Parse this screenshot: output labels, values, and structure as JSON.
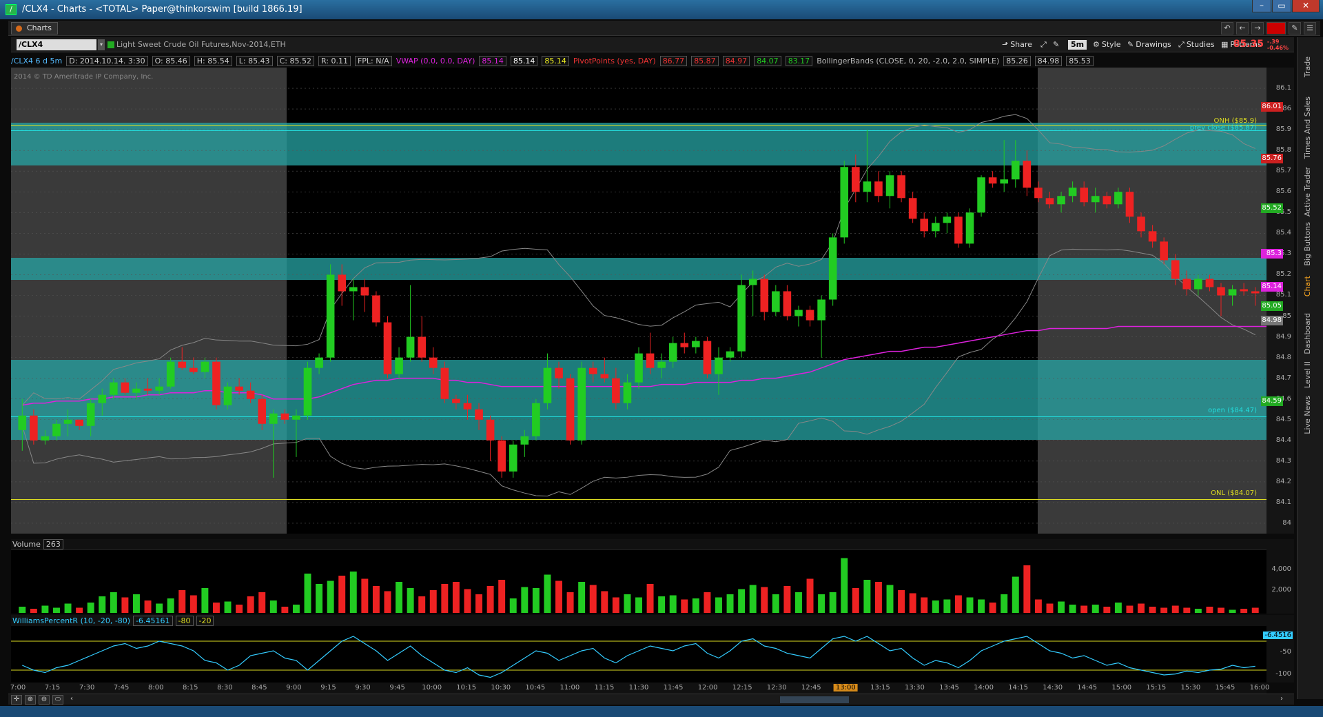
{
  "window": {
    "title": "/CLX4 - Charts - <TOTAL> Paper@thinkorswim [build 1866.19]"
  },
  "tab": {
    "label": "Charts"
  },
  "symbol": {
    "value": "/CLX4",
    "description": "Light Sweet Crude Oil Futures,Nov-2014,ETH"
  },
  "toolbar": {
    "share": "Share",
    "period": "5m",
    "style": "Style",
    "drawings": "Drawings",
    "studies": "Studies",
    "patterns": "Patterns",
    "last_price": "85.35",
    "change_top": "-.39",
    "change_bottom": "-0.46%"
  },
  "studybar": {
    "aggregation": "/CLX4 6 d 5m",
    "date": "D: 2014.10.14. 3:30",
    "open": "O: 85.46",
    "high": "H: 85.54",
    "low": "L: 85.43",
    "close": "C: 85.52",
    "range": "R: 0.11",
    "fpl": "FPL: N/A",
    "vwap_label": "VWAP (0.0, 0.0, DAY)",
    "vwap_v1": "85.14",
    "vwap_v2": "85.14",
    "vwap_v3": "85.14",
    "pivot_label": "PivotPoints (yes, DAY)",
    "pivot_v1": "86.77",
    "pivot_v2": "85.87",
    "pivot_v3": "84.97",
    "pivot_v4": "84.07",
    "pivot_v5": "83.17",
    "bb_label": "BollingerBands (CLOSE, 0, 20, -2.0, 2.0, SIMPLE)",
    "bb_v1": "85.26",
    "bb_v2": "84.98",
    "bb_v3": "85.53"
  },
  "chart": {
    "copyright": "2014 © TD Ameritrade IP Company, Inc.",
    "onh_label": "ONH ($85.9)",
    "prevclose_label": "prev close ($85.87)",
    "open_label": "open ($84.47)",
    "onl_label": "ONL ($84.07)",
    "axis_ticks": [
      "86.1",
      "86",
      "85.9",
      "85.8",
      "85.7",
      "85.6",
      "85.5",
      "85.4",
      "85.3",
      "85.2",
      "85.1",
      "85",
      "84.9",
      "84.8",
      "84.7",
      "84.6",
      "84.5",
      "84.4",
      "84.3",
      "84.2",
      "84.1",
      "84"
    ],
    "tags": [
      {
        "text": "86.01",
        "color": "#cc2020",
        "price": 86.01
      },
      {
        "text": "85.76",
        "color": "#cc2020",
        "price": 85.76
      },
      {
        "text": "85.52",
        "color": "#22aa22",
        "price": 85.52
      },
      {
        "text": "85.3",
        "color": "#dd22dd",
        "price": 85.3
      },
      {
        "text": "85.14",
        "color": "#dd22dd",
        "price": 85.14
      },
      {
        "text": "85.05",
        "color": "#22aa22",
        "price": 85.05
      },
      {
        "text": "84.98",
        "color": "#777777",
        "price": 84.98
      },
      {
        "text": "84.59",
        "color": "#22aa22",
        "price": 84.59
      }
    ]
  },
  "volume": {
    "label": "Volume",
    "value": "263",
    "ticks": [
      "4,000",
      "2,000"
    ]
  },
  "williams": {
    "label": "WilliamsPercentR (10, -20, -80)",
    "value": "-6.45161",
    "p1": "-80",
    "p2": "-20",
    "tag": "-6.4516",
    "ticks": [
      "-50",
      "-100"
    ]
  },
  "timeaxis": {
    "labels": [
      "7:00",
      "7:15",
      "7:30",
      "7:45",
      "8:00",
      "8:15",
      "8:30",
      "8:45",
      "9:00",
      "9:15",
      "9:30",
      "9:45",
      "10:00",
      "10:15",
      "10:30",
      "10:45",
      "11:00",
      "11:15",
      "11:30",
      "11:45",
      "12:00",
      "12:15",
      "12:30",
      "12:45",
      "13:00",
      "13:15",
      "13:30",
      "13:45",
      "14:00",
      "14:15",
      "14:30",
      "14:45",
      "15:00",
      "15:15",
      "15:30",
      "15:45",
      "16:00"
    ],
    "highlight": "13:00"
  },
  "sidetabs": [
    "Trade",
    "Times And Sales",
    "Active Trader",
    "Big Buttons",
    "Chart",
    "Dashboard",
    "Level II",
    "Live News"
  ],
  "colors": {
    "up": "#22cc22",
    "down": "#ee2222",
    "band": "#27a5a5",
    "vwap": "#dd22dd",
    "bollinger": "#888888"
  },
  "chart_data": {
    "type": "candlestick",
    "ylim": [
      83.95,
      86.2
    ],
    "candles": [
      [
        84.45,
        84.6,
        84.35,
        84.52
      ],
      [
        84.52,
        84.55,
        84.38,
        84.4
      ],
      [
        84.4,
        84.45,
        84.38,
        84.42
      ],
      [
        84.42,
        84.5,
        84.4,
        84.48
      ],
      [
        84.48,
        84.55,
        84.42,
        84.5
      ],
      [
        84.5,
        84.5,
        84.45,
        84.47
      ],
      [
        84.47,
        84.6,
        84.42,
        84.58
      ],
      [
        84.58,
        84.65,
        84.52,
        84.62
      ],
      [
        84.62,
        84.7,
        84.6,
        84.68
      ],
      [
        84.68,
        84.7,
        84.62,
        84.63
      ],
      [
        84.63,
        84.68,
        84.6,
        84.65
      ],
      [
        84.65,
        84.7,
        84.62,
        84.64
      ],
      [
        84.64,
        84.7,
        84.62,
        84.66
      ],
      [
        84.66,
        84.8,
        84.65,
        84.78
      ],
      [
        84.78,
        84.85,
        84.74,
        84.75
      ],
      [
        84.75,
        84.8,
        84.72,
        84.73
      ],
      [
        84.73,
        84.8,
        84.7,
        84.78
      ],
      [
        84.78,
        84.8,
        84.55,
        84.57
      ],
      [
        84.57,
        84.68,
        84.55,
        84.66
      ],
      [
        84.66,
        84.7,
        84.62,
        84.64
      ],
      [
        84.64,
        84.68,
        84.58,
        84.6
      ],
      [
        84.6,
        84.62,
        84.45,
        84.48
      ],
      [
        84.48,
        84.55,
        84.22,
        84.53
      ],
      [
        84.53,
        84.55,
        84.48,
        84.5
      ],
      [
        84.5,
        84.55,
        84.32,
        84.52
      ],
      [
        84.52,
        84.78,
        84.5,
        84.75
      ],
      [
        84.75,
        84.82,
        84.72,
        84.8
      ],
      [
        84.8,
        85.25,
        84.78,
        85.2
      ],
      [
        85.2,
        85.25,
        85.05,
        85.12
      ],
      [
        85.12,
        85.18,
        84.98,
        85.14
      ],
      [
        85.14,
        85.18,
        85.02,
        85.1
      ],
      [
        85.1,
        85.12,
        84.95,
        84.97
      ],
      [
        84.97,
        85.0,
        84.7,
        84.72
      ],
      [
        84.72,
        84.85,
        84.7,
        84.8
      ],
      [
        84.8,
        85.15,
        84.78,
        84.9
      ],
      [
        84.9,
        85.0,
        84.78,
        84.8
      ],
      [
        84.8,
        84.85,
        84.72,
        84.75
      ],
      [
        84.75,
        84.78,
        84.58,
        84.6
      ],
      [
        84.6,
        84.62,
        84.55,
        84.58
      ],
      [
        84.58,
        84.62,
        84.5,
        84.55
      ],
      [
        84.55,
        84.58,
        84.45,
        84.5
      ],
      [
        84.5,
        84.52,
        84.3,
        84.4
      ],
      [
        84.4,
        84.42,
        84.22,
        84.25
      ],
      [
        84.25,
        84.4,
        84.22,
        84.38
      ],
      [
        84.38,
        84.45,
        84.32,
        84.42
      ],
      [
        84.42,
        84.6,
        84.4,
        84.58
      ],
      [
        84.58,
        84.82,
        84.55,
        84.75
      ],
      [
        84.75,
        84.78,
        84.65,
        84.7
      ],
      [
        84.7,
        84.72,
        84.38,
        84.4
      ],
      [
        84.4,
        84.78,
        84.38,
        84.75
      ],
      [
        84.75,
        84.78,
        84.68,
        84.72
      ],
      [
        84.72,
        84.8,
        84.68,
        84.7
      ],
      [
        84.7,
        84.75,
        84.55,
        84.58
      ],
      [
        84.58,
        84.72,
        84.55,
        84.68
      ],
      [
        84.68,
        84.85,
        84.65,
        84.82
      ],
      [
        84.82,
        84.92,
        84.72,
        84.75
      ],
      [
        84.75,
        84.82,
        84.7,
        84.78
      ],
      [
        84.78,
        84.9,
        84.75,
        84.87
      ],
      [
        84.87,
        84.92,
        84.82,
        84.85
      ],
      [
        84.85,
        84.9,
        84.82,
        84.88
      ],
      [
        84.88,
        84.9,
        84.7,
        84.72
      ],
      [
        84.72,
        84.85,
        84.62,
        84.8
      ],
      [
        84.8,
        84.85,
        84.78,
        84.83
      ],
      [
        84.83,
        85.2,
        84.8,
        85.15
      ],
      [
        85.15,
        85.22,
        85.0,
        85.18
      ],
      [
        85.18,
        85.2,
        84.98,
        85.02
      ],
      [
        85.02,
        85.15,
        85.0,
        85.12
      ],
      [
        85.12,
        85.15,
        84.98,
        85.0
      ],
      [
        85.0,
        85.05,
        84.95,
        85.03
      ],
      [
        85.03,
        85.05,
        84.95,
        84.98
      ],
      [
        84.98,
        85.1,
        84.8,
        85.08
      ],
      [
        85.08,
        85.4,
        85.05,
        85.38
      ],
      [
        85.38,
        85.75,
        85.35,
        85.72
      ],
      [
        85.72,
        85.78,
        85.55,
        85.6
      ],
      [
        85.6,
        85.9,
        85.55,
        85.65
      ],
      [
        85.65,
        85.7,
        85.55,
        85.58
      ],
      [
        85.58,
        85.7,
        85.52,
        85.68
      ],
      [
        85.68,
        85.7,
        85.55,
        85.57
      ],
      [
        85.57,
        85.6,
        85.45,
        85.47
      ],
      [
        85.47,
        85.5,
        85.38,
        85.41
      ],
      [
        85.41,
        85.48,
        85.38,
        85.45
      ],
      [
        85.45,
        85.5,
        85.4,
        85.48
      ],
      [
        85.48,
        85.5,
        85.33,
        85.35
      ],
      [
        85.35,
        85.52,
        85.33,
        85.5
      ],
      [
        85.5,
        85.68,
        85.48,
        85.67
      ],
      [
        85.67,
        85.7,
        85.62,
        85.64
      ],
      [
        85.64,
        85.85,
        85.6,
        85.66
      ],
      [
        85.66,
        85.85,
        85.62,
        85.75
      ],
      [
        85.75,
        85.8,
        85.58,
        85.62
      ],
      [
        85.62,
        85.65,
        85.55,
        85.57
      ],
      [
        85.57,
        85.6,
        85.52,
        85.54
      ],
      [
        85.54,
        85.6,
        85.5,
        85.58
      ],
      [
        85.58,
        85.65,
        85.55,
        85.62
      ],
      [
        85.62,
        85.65,
        85.53,
        85.55
      ],
      [
        85.55,
        85.62,
        85.5,
        85.58
      ],
      [
        85.58,
        85.6,
        85.52,
        85.54
      ],
      [
        85.54,
        85.62,
        85.52,
        85.6
      ],
      [
        85.6,
        85.62,
        85.45,
        85.48
      ],
      [
        85.48,
        85.5,
        85.38,
        85.41
      ],
      [
        85.41,
        85.44,
        85.33,
        85.36
      ],
      [
        85.36,
        85.38,
        85.25,
        85.27
      ],
      [
        85.27,
        85.3,
        85.15,
        85.18
      ],
      [
        85.18,
        85.22,
        85.1,
        85.13
      ],
      [
        85.13,
        85.2,
        85.1,
        85.18
      ],
      [
        85.18,
        85.2,
        85.12,
        85.14
      ],
      [
        85.14,
        85.16,
        85.0,
        85.1
      ],
      [
        85.1,
        85.15,
        85.05,
        85.13
      ],
      [
        85.13,
        85.16,
        85.1,
        85.12
      ],
      [
        85.12,
        85.14,
        85.05,
        85.11
      ]
    ],
    "volumes": [
      600,
      400,
      700,
      500,
      900,
      500,
      1000,
      1600,
      2000,
      1500,
      1800,
      1200,
      900,
      1400,
      2200,
      1700,
      2400,
      1000,
      1100,
      800,
      1600,
      2000,
      1200,
      600,
      800,
      3800,
      2800,
      3100,
      3600,
      4000,
      3300,
      2600,
      2100,
      3000,
      2400,
      1600,
      2200,
      2800,
      3000,
      2300,
      1800,
      2600,
      3200,
      1400,
      2500,
      2400,
      3700,
      3100,
      2000,
      3000,
      2700,
      2100,
      1500,
      1800,
      1500,
      2800,
      1600,
      1700,
      1300,
      1400,
      2000,
      1500,
      1800,
      2300,
      2700,
      2500,
      1800,
      2600,
      2000,
      3300,
      1800,
      2000,
      5300,
      2400,
      3200,
      3000,
      2700,
      2200,
      1900,
      1500,
      1200,
      1300,
      1700,
      1500,
      1300,
      1000,
      1800,
      3500,
      4600,
      1300,
      900,
      1100,
      800,
      700,
      800,
      600,
      1000,
      700,
      900,
      600,
      500,
      700,
      500,
      400,
      600,
      500,
      300,
      400,
      500,
      300
    ],
    "vwap": [
      84.57,
      84.58,
      84.58,
      84.59,
      84.59,
      84.59,
      84.6,
      84.6,
      84.61,
      84.61,
      84.61,
      84.62,
      84.62,
      84.63,
      84.63,
      84.63,
      84.64,
      84.64,
      84.63,
      84.63,
      84.63,
      84.62,
      84.6,
      84.6,
      84.6,
      84.6,
      84.61,
      84.63,
      84.65,
      84.67,
      84.68,
      84.69,
      84.69,
      84.7,
      84.7,
      84.7,
      84.7,
      84.69,
      84.69,
      84.68,
      84.68,
      84.67,
      84.66,
      84.66,
      84.66,
      84.66,
      84.66,
      84.66,
      84.66,
      84.66,
      84.66,
      84.66,
      84.66,
      84.66,
      84.66,
      84.66,
      84.67,
      84.67,
      84.67,
      84.68,
      84.68,
      84.68,
      84.68,
      84.69,
      84.69,
      84.7,
      84.7,
      84.71,
      84.72,
      84.73,
      84.75,
      84.77,
      84.79,
      84.8,
      84.81,
      84.82,
      84.83,
      84.83,
      84.84,
      84.85,
      84.85,
      84.86,
      84.87,
      84.88,
      84.89,
      84.9,
      84.91,
      84.92,
      84.93,
      84.93,
      84.94,
      84.94,
      84.94,
      84.94,
      84.94,
      84.94,
      84.95,
      84.95,
      84.95,
      84.95,
      84.95,
      84.95,
      84.95,
      84.95,
      84.95,
      84.95,
      84.95,
      84.95,
      84.95,
      84.95
    ],
    "williams": [
      -70,
      -80,
      -85,
      -75,
      -70,
      -60,
      -50,
      -40,
      -30,
      -25,
      -35,
      -30,
      -20,
      -25,
      -30,
      -40,
      -60,
      -65,
      -80,
      -70,
      -50,
      -45,
      -40,
      -55,
      -60,
      -80,
      -60,
      -40,
      -20,
      -10,
      -25,
      -40,
      -60,
      -45,
      -30,
      -50,
      -65,
      -80,
      -85,
      -75,
      -90,
      -95,
      -85,
      -70,
      -55,
      -40,
      -45,
      -60,
      -50,
      -40,
      -35,
      -55,
      -65,
      -50,
      -40,
      -30,
      -35,
      -40,
      -30,
      -25,
      -45,
      -55,
      -40,
      -20,
      -15,
      -30,
      -35,
      -45,
      -50,
      -55,
      -35,
      -15,
      -10,
      -20,
      -10,
      -25,
      -40,
      -35,
      -55,
      -70,
      -60,
      -65,
      -75,
      -60,
      -40,
      -30,
      -20,
      -15,
      -10,
      -25,
      -40,
      -45,
      -55,
      -50,
      -60,
      -70,
      -65,
      -75,
      -80,
      -85,
      -90,
      -88,
      -82,
      -85,
      -80,
      -78,
      -70,
      -75,
      -72,
      -6
    ]
  }
}
